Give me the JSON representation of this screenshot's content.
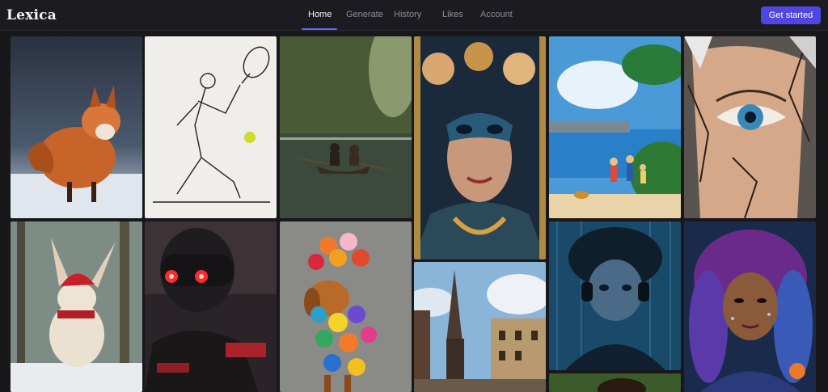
{
  "app": {
    "logo": "Lexica"
  },
  "nav": {
    "items": [
      "Home",
      "Generate",
      "History",
      "Likes",
      "Account"
    ],
    "active": "Home"
  },
  "header": {
    "cta_label": "Get started"
  },
  "gallery": {
    "tiles": [
      "fox-in-snow-image",
      "tennis-player-sketch-image",
      "couple-rowing-boat-image",
      "masked-woman-portrait-image",
      "children-by-lake-image",
      "cracked-eye-portrait-image",
      "bunny-santa-hat-image",
      "red-eyed-robot-image",
      "dog-with-balloons-image",
      "gothic-cathedral-street-image",
      "boy-with-headphones-image",
      "cosmic-woman-portrait-image"
    ]
  },
  "colors": {
    "accent": "#4f46e5",
    "background": "#1a1a1d",
    "nav_active_underline": "#6366f1"
  }
}
